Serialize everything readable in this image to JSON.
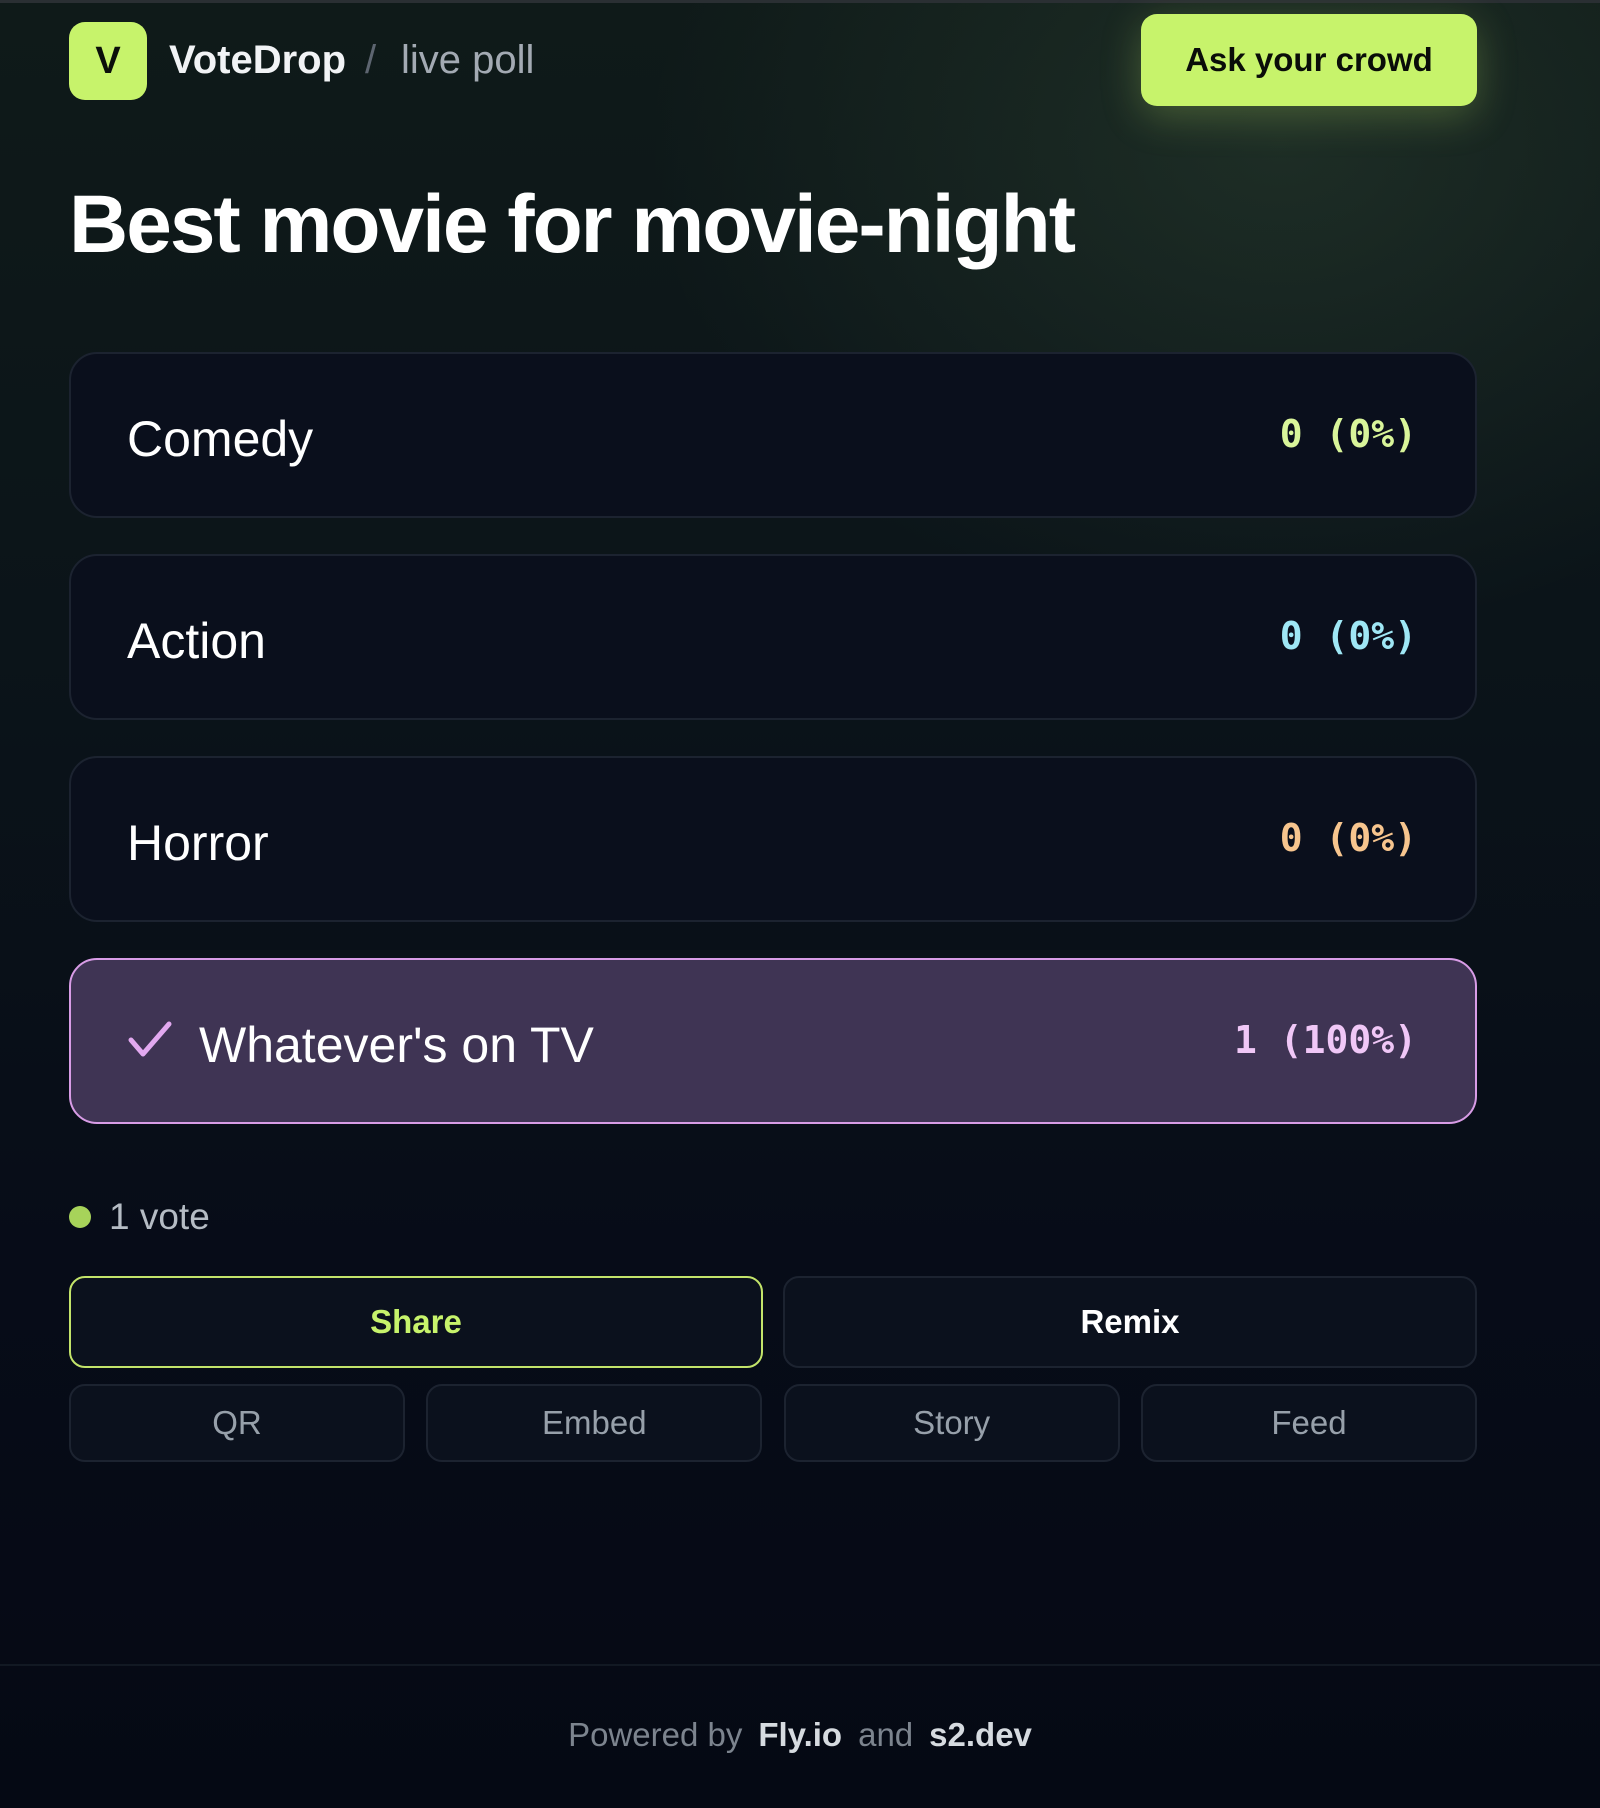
{
  "header": {
    "logo_letter": "V",
    "brand": "VoteDrop",
    "separator": "/",
    "crumb": "live poll",
    "cta_label": "Ask your crowd"
  },
  "poll": {
    "title": "Best movie for movie-night",
    "options": [
      {
        "label": "Comedy",
        "count": "0 (0%)",
        "color": "#d9f59a",
        "selected": false
      },
      {
        "label": "Action",
        "count": "0 (0%)",
        "color": "#9fe7f5",
        "selected": false
      },
      {
        "label": "Horror",
        "count": "0 (0%)",
        "color": "#f7c58e",
        "selected": false
      },
      {
        "label": "Whatever's on TV",
        "count": "1 (100%)",
        "color": "#f0c7f7",
        "selected": true
      }
    ],
    "votes_text": "1 vote"
  },
  "actions": {
    "share_label": "Share",
    "remix_label": "Remix",
    "qr_label": "QR",
    "embed_label": "Embed",
    "story_label": "Story",
    "feed_label": "Feed"
  },
  "footer": {
    "prefix": "Powered by",
    "fly": "Fly.io",
    "and": "and",
    "s2": "s2.dev"
  },
  "colors": {
    "accent": "#c7f36b",
    "selected_bg": "#3f3454",
    "selected_border": "#d89ce6",
    "check": "#e2a9f0"
  }
}
